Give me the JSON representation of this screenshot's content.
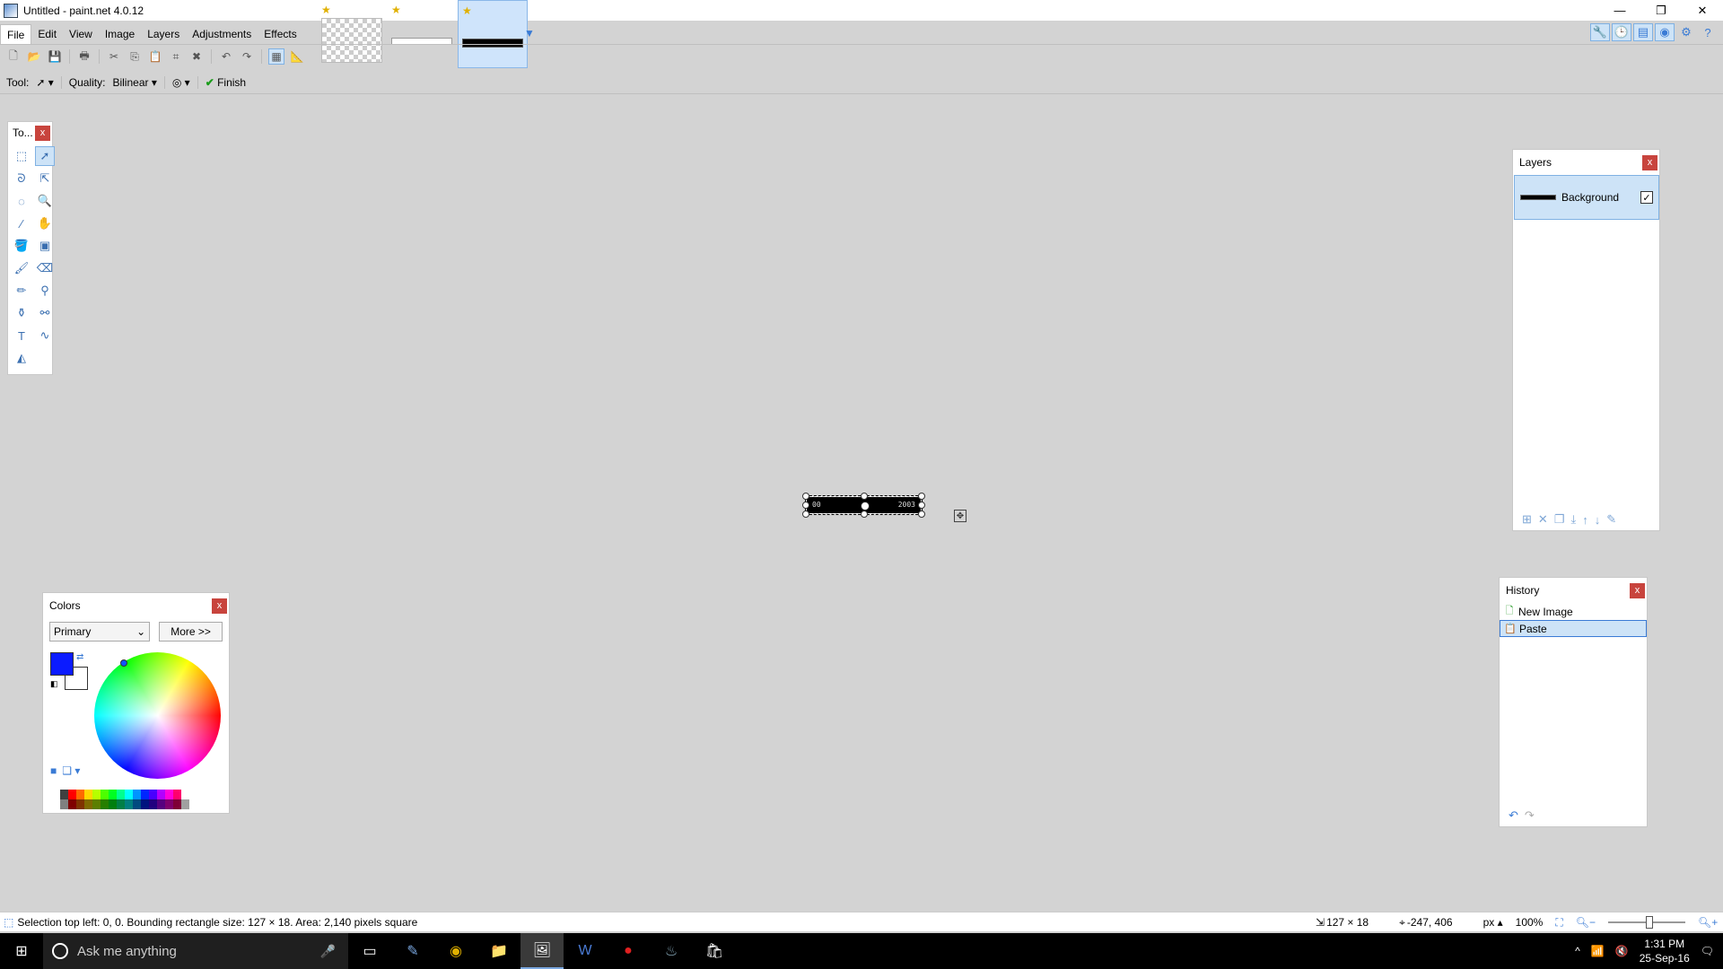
{
  "titlebar": {
    "title": "Untitled - paint.net 4.0.12",
    "minimize": "—",
    "restore": "❐",
    "close": "✕"
  },
  "menu": [
    "File",
    "Edit",
    "View",
    "Image",
    "Layers",
    "Adjustments",
    "Effects"
  ],
  "toolbar": {
    "tool_label": "Tool:",
    "quality_label": "Quality:",
    "quality_value": "Bilinear",
    "finish_label": "Finish"
  },
  "tools_window": {
    "title": "To...",
    "close": "x"
  },
  "layers_window": {
    "title": "Layers",
    "close": "x",
    "layers": [
      {
        "name": "Background",
        "visible": true
      }
    ]
  },
  "history_window": {
    "title": "History",
    "close": "x",
    "items": [
      {
        "label": "New Image"
      },
      {
        "label": "Paste",
        "selected": true
      }
    ]
  },
  "colors_window": {
    "title": "Colors",
    "close": "x",
    "mode": "Primary",
    "more_button": "More >>",
    "primary_color": "#0b1bff",
    "secondary_color": "#ffffff",
    "palette": [
      "#404040",
      "#ff0000",
      "#ff6a00",
      "#ffd800",
      "#b6ff00",
      "#4cff00",
      "#00ff21",
      "#00ff90",
      "#00ffff",
      "#0094ff",
      "#0026ff",
      "#4800ff",
      "#b200ff",
      "#ff00dc",
      "#ff006e",
      "#ffffff",
      "#808080",
      "#7f0000",
      "#7f3300",
      "#7f6a00",
      "#5b7f00",
      "#267f00",
      "#007f0e",
      "#007f46",
      "#007f7f",
      "#004a7f",
      "#00137f",
      "#21007f",
      "#57007f",
      "#7f006e",
      "#7f0037",
      "#a0a0a0"
    ]
  },
  "canvas": {
    "left_text": "00",
    "right_text": "2003"
  },
  "status": {
    "message": "Selection top left: 0, 0. Bounding rectangle size: 127 × 18. Area: 2,140 pixels square",
    "size": "127 × 18",
    "cursor": "-247, 406",
    "units": "px",
    "zoom": "100%"
  },
  "taskbar": {
    "search_placeholder": "Ask me anything",
    "time": "1:31 PM",
    "date": "25-Sep-16"
  }
}
